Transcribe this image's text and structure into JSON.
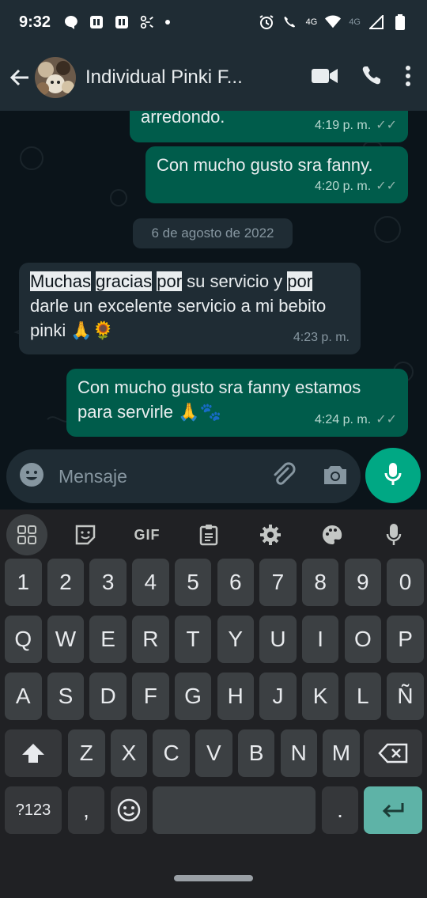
{
  "status": {
    "time": "9:32",
    "net_label_1": "4G",
    "net_label_2": "4G"
  },
  "header": {
    "contact_name": "Individual Pinki F...",
    "icons": [
      "back-arrow-icon",
      "video-call-icon",
      "phone-icon",
      "more-vert-icon"
    ]
  },
  "messages": [
    {
      "direction": "out",
      "text": "arredondo.",
      "time": "4:19 p. m.",
      "ticks": "✓✓"
    },
    {
      "direction": "out",
      "text": "Con mucho gusto sra fanny.",
      "time": "4:20 p. m.",
      "ticks": "✓✓"
    },
    {
      "direction": "in",
      "parts": [
        "Muchas",
        " ",
        "gracias",
        " ",
        "por",
        " su servicio y ",
        "por",
        " darle un excelente servicio a mi bebito pinki 🙏🌻"
      ],
      "time": "4:23 p. m."
    },
    {
      "direction": "out",
      "text": "Con mucho gusto sra fanny estamos para servirle 🙏🐾",
      "time": "4:24 p. m.",
      "ticks": "✓✓"
    }
  ],
  "date_chip": "6 de agosto de 2022",
  "composer": {
    "placeholder": "Mensaje"
  },
  "keyboard": {
    "toolbar": {
      "gif": "GIF"
    },
    "numbers": [
      "1",
      "2",
      "3",
      "4",
      "5",
      "6",
      "7",
      "8",
      "9",
      "0"
    ],
    "row1": [
      "Q",
      "W",
      "E",
      "R",
      "T",
      "Y",
      "U",
      "I",
      "O",
      "P"
    ],
    "row2": [
      "A",
      "S",
      "D",
      "F",
      "G",
      "H",
      "J",
      "K",
      "L",
      "Ñ"
    ],
    "row3": [
      "Z",
      "X",
      "C",
      "V",
      "B",
      "N",
      "M"
    ],
    "symbols": "?123",
    "comma": ",",
    "period": "."
  },
  "colors": {
    "outgoing_bubble": "#005c4b",
    "incoming_bubble": "#1f2c34",
    "accent": "#00a884"
  }
}
